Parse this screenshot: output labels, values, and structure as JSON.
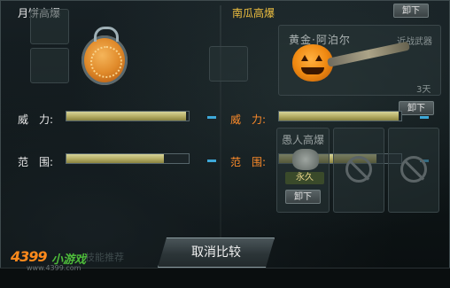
{
  "left_panel": {
    "title": "月饼高爆",
    "stats": [
      {
        "label": "威　力:",
        "fill": 0.98,
        "diff": "−"
      },
      {
        "label": "范　围:",
        "fill": 0.8,
        "diff": "−"
      }
    ]
  },
  "right_panel": {
    "title": "南瓜高爆",
    "weapon": {
      "name": "黄金·阿泊尔",
      "type": "近战武器",
      "duration": "3天",
      "unequip": "卸下"
    },
    "top_unequip": "卸下",
    "stats": [
      {
        "label": "威　力:",
        "fill": 0.98,
        "diff": "−"
      },
      {
        "label": "范　围:",
        "fill": 0.8,
        "diff": "−"
      }
    ],
    "explosive": {
      "name": "愚人高爆",
      "badge": "永久",
      "unequip": "卸下"
    }
  },
  "footer": {
    "compare_button": "取消比较",
    "faded_label": "技能推荐",
    "logo_main": "4399",
    "logo_sub": "小游戏",
    "logo_url": "www.4399.com"
  },
  "colors": {
    "accent_orange": "#ff8c2a",
    "bar_fill": "#b8b068",
    "dash_blue": "#3ea8d8"
  }
}
